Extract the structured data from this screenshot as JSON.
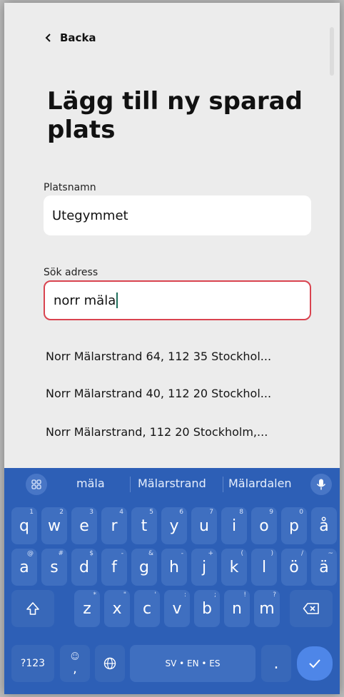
{
  "nav": {
    "back_label": "Backa"
  },
  "page": {
    "title": "Lägg till ny sparad plats"
  },
  "form": {
    "name_label": "Platsnamn",
    "name_value": "Utegymmet",
    "address_label": "Sök adress",
    "address_value": "norr mäla"
  },
  "suggestions": [
    "Norr Mälarstrand 64, 112 35 Stockhol...",
    "Norr Mälarstrand 40, 112 20 Stockhol...",
    "Norr Mälarstrand, 112 20 Stockholm,..."
  ],
  "keyboard": {
    "word_suggestions": [
      "mäla",
      "Mälarstrand",
      "Mälardalen"
    ],
    "row1": [
      {
        "k": "q",
        "s": "1"
      },
      {
        "k": "w",
        "s": "2"
      },
      {
        "k": "e",
        "s": "3"
      },
      {
        "k": "r",
        "s": "4"
      },
      {
        "k": "t",
        "s": "5"
      },
      {
        "k": "y",
        "s": "6"
      },
      {
        "k": "u",
        "s": "7"
      },
      {
        "k": "i",
        "s": "8"
      },
      {
        "k": "o",
        "s": "9"
      },
      {
        "k": "p",
        "s": "0"
      },
      {
        "k": "å",
        "s": ""
      }
    ],
    "row2": [
      {
        "k": "a",
        "s": "@"
      },
      {
        "k": "s",
        "s": "#"
      },
      {
        "k": "d",
        "s": "$"
      },
      {
        "k": "f",
        "s": "-"
      },
      {
        "k": "g",
        "s": "&"
      },
      {
        "k": "h",
        "s": "-"
      },
      {
        "k": "j",
        "s": "+"
      },
      {
        "k": "k",
        "s": "("
      },
      {
        "k": "l",
        "s": ")"
      },
      {
        "k": "ö",
        "s": "/"
      },
      {
        "k": "ä",
        "s": "~"
      }
    ],
    "row3": [
      {
        "k": "z",
        "s": "*"
      },
      {
        "k": "x",
        "s": "\""
      },
      {
        "k": "c",
        "s": "'"
      },
      {
        "k": "v",
        "s": ":"
      },
      {
        "k": "b",
        "s": ";"
      },
      {
        "k": "n",
        "s": "!"
      },
      {
        "k": "m",
        "s": "?"
      }
    ],
    "symbols_label": "?123",
    "comma_label": ",",
    "comma_sub": "☺",
    "space_label": "SV • EN • ES",
    "period_label": "."
  },
  "colors": {
    "accent_border": "#d9434f",
    "keyboard_bg": "#2d5fb6",
    "enter_bg": "#4e86e8"
  },
  "icons": [
    "back-chevron-icon",
    "grid-icon",
    "microphone-icon",
    "shift-icon",
    "backspace-icon",
    "globe-icon",
    "checkmark-icon"
  ]
}
